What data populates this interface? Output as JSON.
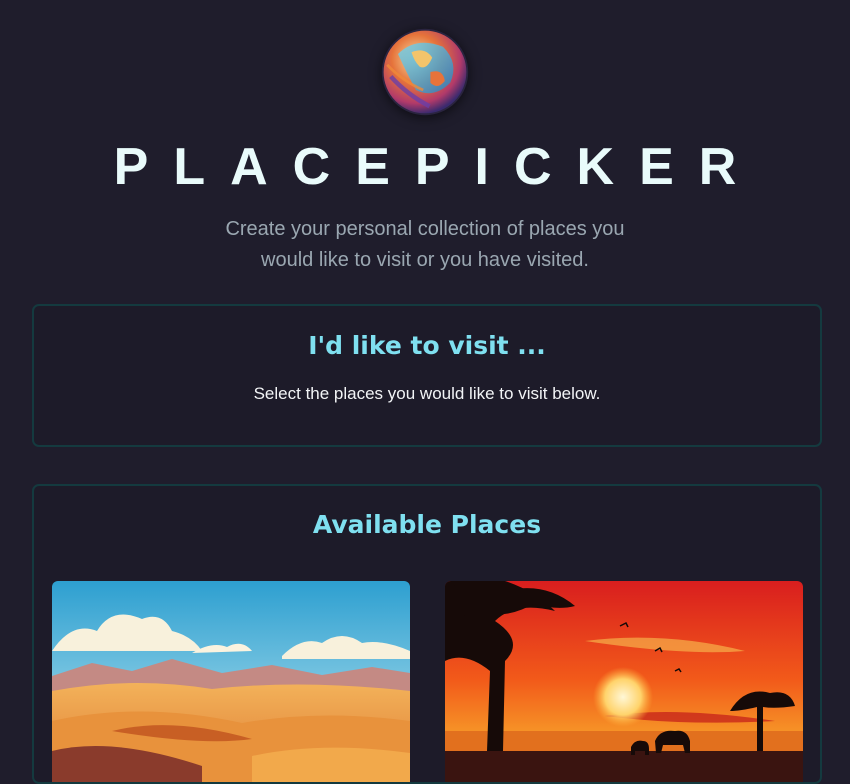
{
  "header": {
    "logo_icon": "globe-logo-icon",
    "title": "PLACEPICKER",
    "tagline": "Create your personal collection of places you would like to visit or you have visited."
  },
  "selected_places": {
    "title": "I'd like to visit ...",
    "fallback_text": "Select the places you would like to visit below."
  },
  "available_places": {
    "title": "Available Places",
    "places": [
      {
        "image": "desert-dunes-illustration"
      },
      {
        "image": "african-savanna-sunset-illustration"
      }
    ]
  },
  "colors": {
    "background": "#1f1d2c",
    "title": "#e9fbfb",
    "accent": "#7fe0f0",
    "panel_border": "#143a3f"
  }
}
